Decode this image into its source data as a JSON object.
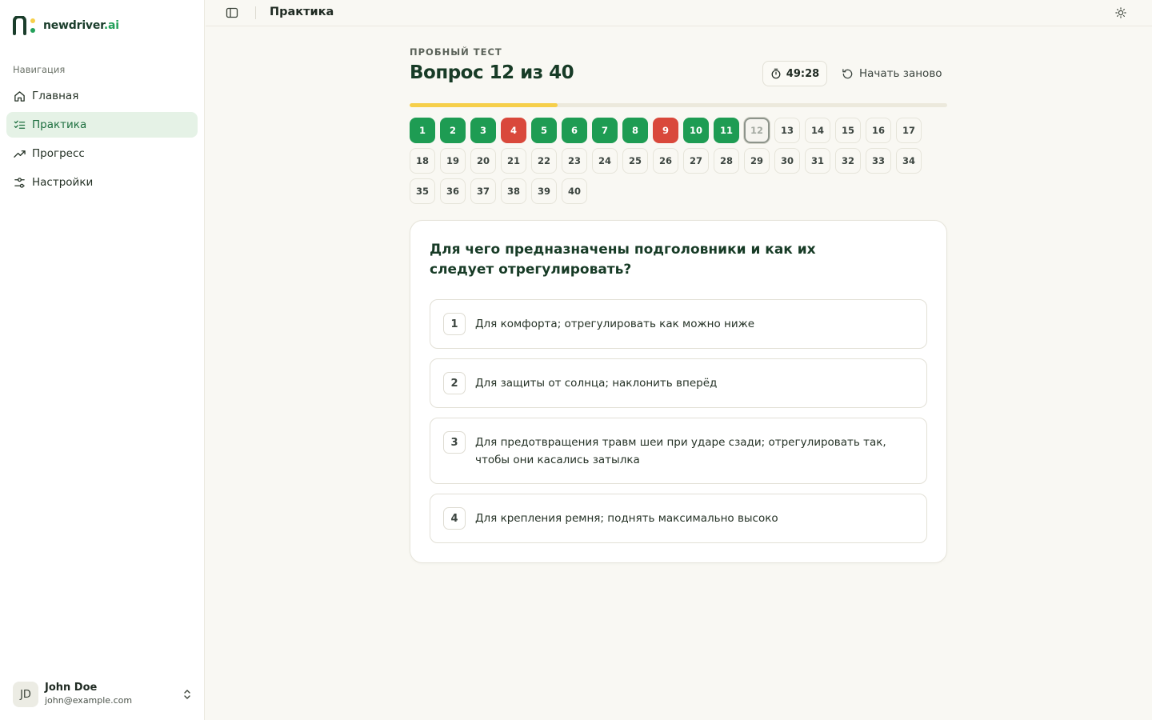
{
  "app": {
    "brand_name": "newdriver",
    "brand_suffix": ".ai"
  },
  "sidebar": {
    "heading": "Навигация",
    "items": [
      {
        "label": "Главная",
        "icon": "home-icon",
        "active": false
      },
      {
        "label": "Практика",
        "icon": "list-check-icon",
        "active": true
      },
      {
        "label": "Прогресс",
        "icon": "trending-up-icon",
        "active": false
      },
      {
        "label": "Настройки",
        "icon": "sliders-icon",
        "active": false
      }
    ],
    "user": {
      "initials": "JD",
      "name": "John Doe",
      "email": "john@example.com"
    }
  },
  "topbar": {
    "title": "Практика"
  },
  "test": {
    "eyebrow": "ПРОБНЫЙ ТЕСТ",
    "title": "Вопрос 12 из 40",
    "timer": "49:28",
    "restart_label": "Начать заново",
    "progress_fraction": 0.275,
    "questions": [
      {
        "n": "1",
        "status": "correct"
      },
      {
        "n": "2",
        "status": "correct"
      },
      {
        "n": "3",
        "status": "correct"
      },
      {
        "n": "4",
        "status": "wrong"
      },
      {
        "n": "5",
        "status": "correct"
      },
      {
        "n": "6",
        "status": "correct"
      },
      {
        "n": "7",
        "status": "correct"
      },
      {
        "n": "8",
        "status": "correct"
      },
      {
        "n": "9",
        "status": "wrong"
      },
      {
        "n": "10",
        "status": "correct"
      },
      {
        "n": "11",
        "status": "correct"
      },
      {
        "n": "12",
        "status": "current"
      },
      {
        "n": "13",
        "status": "pending"
      },
      {
        "n": "14",
        "status": "pending"
      },
      {
        "n": "15",
        "status": "pending"
      },
      {
        "n": "16",
        "status": "pending"
      },
      {
        "n": "17",
        "status": "pending"
      },
      {
        "n": "18",
        "status": "pending"
      },
      {
        "n": "19",
        "status": "pending"
      },
      {
        "n": "20",
        "status": "pending"
      },
      {
        "n": "21",
        "status": "pending"
      },
      {
        "n": "22",
        "status": "pending"
      },
      {
        "n": "23",
        "status": "pending"
      },
      {
        "n": "24",
        "status": "pending"
      },
      {
        "n": "25",
        "status": "pending"
      },
      {
        "n": "26",
        "status": "pending"
      },
      {
        "n": "27",
        "status": "pending"
      },
      {
        "n": "28",
        "status": "pending"
      },
      {
        "n": "29",
        "status": "pending"
      },
      {
        "n": "30",
        "status": "pending"
      },
      {
        "n": "31",
        "status": "pending"
      },
      {
        "n": "32",
        "status": "pending"
      },
      {
        "n": "33",
        "status": "pending"
      },
      {
        "n": "34",
        "status": "pending"
      },
      {
        "n": "35",
        "status": "pending"
      },
      {
        "n": "36",
        "status": "pending"
      },
      {
        "n": "37",
        "status": "pending"
      },
      {
        "n": "38",
        "status": "pending"
      },
      {
        "n": "39",
        "status": "pending"
      },
      {
        "n": "40",
        "status": "pending"
      }
    ],
    "question_text": "Для чего предназначены подголовники и как их следует отрегулировать?",
    "options": [
      {
        "num": "1",
        "text": "Для комфорта; отрегулировать как можно ниже"
      },
      {
        "num": "2",
        "text": "Для защиты от солнца; наклонить вперёд"
      },
      {
        "num": "3",
        "text": "Для предотвращения травм шеи при ударе сзади; отрегулировать так, чтобы они касались затылка"
      },
      {
        "num": "4",
        "text": "Для крепления ремня; поднять максимально высоко"
      }
    ]
  },
  "colors": {
    "accent_green": "#1e9c53",
    "error_red": "#d9483b",
    "progress_yellow": "#f6cf4a"
  }
}
